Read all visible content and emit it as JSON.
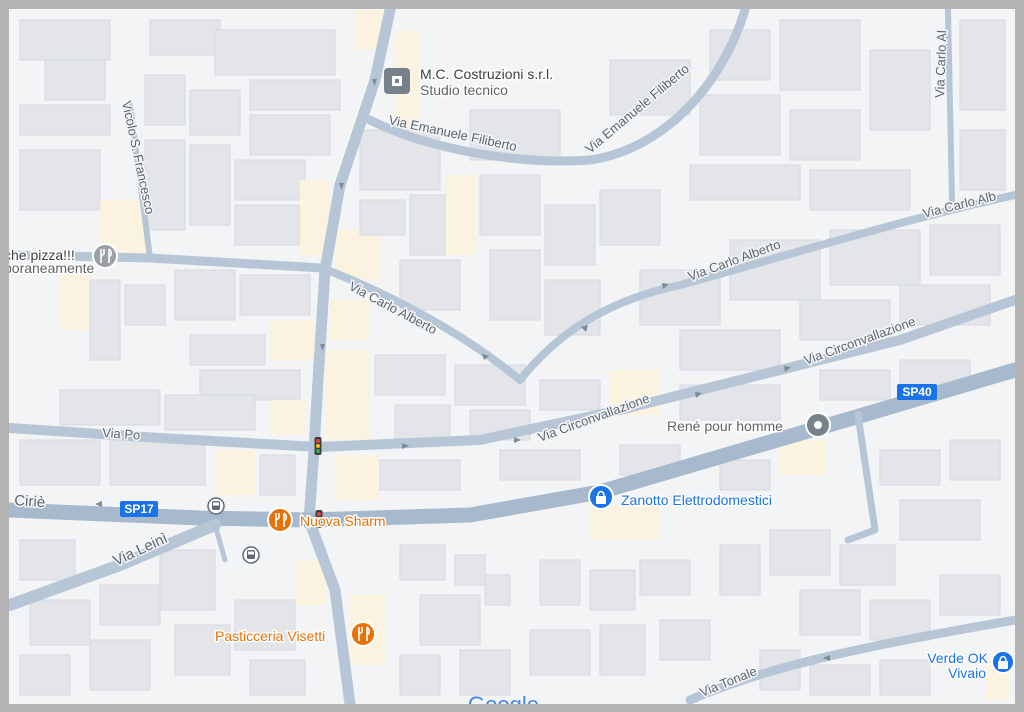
{
  "streets": {
    "via_emanuele_filiberto_1": "Via Emanuele Filiberto",
    "via_emanuele_filiberto_2": "Via Emanuele Filiberto",
    "vicolo_s_francesco": "Vicolo S. Francesco",
    "via_carlo_alberto_1": "Via Carlo Alberto",
    "via_carlo_alberto_2": "Via Carlo Alberto",
    "via_carlo_alberto_3": "Via Carlo Alb",
    "via_carlo_alberto_4": "Via Carlo Al",
    "via_circonvallazione_1": "Via Circonvallazione",
    "via_circonvallazione_2": "Via Circonvallazione",
    "via_po": "Via Po",
    "via_cirie": "Ciriè",
    "via_leini": "Via Leinì",
    "via_tonale": "Via Tonale"
  },
  "shields": {
    "sp17": "SP17",
    "sp40": "SP40"
  },
  "places": {
    "mc_costruzioni": {
      "name": "M.C. Costruzioni s.r.l.",
      "category": "Studio tecnico"
    },
    "pizza": {
      "name": "che pizza!!!",
      "sub": "poraneamente"
    },
    "rene": {
      "name": "René pour homme"
    },
    "zanotto": {
      "name": "Zanotto Elettrodomestici"
    },
    "nuova_sharm": {
      "name": "Nuova Sharm"
    },
    "visetti": {
      "name": "Pasticceria Visetti"
    },
    "verde_ok": {
      "name": "Verde OK",
      "category": "Vivaio"
    }
  },
  "watermark": "Google",
  "colors": {
    "food": "#e8710a",
    "shop": "#1a73e8",
    "generic_pin": "#77818b",
    "road": "#b7c6d6",
    "shield": "#1a73e8"
  },
  "icons": {
    "food": "fork-knife-icon",
    "shop": "shopping-bag-icon",
    "bus": "bus-icon",
    "traffic_light": "traffic-light-icon",
    "business": "building-icon"
  }
}
